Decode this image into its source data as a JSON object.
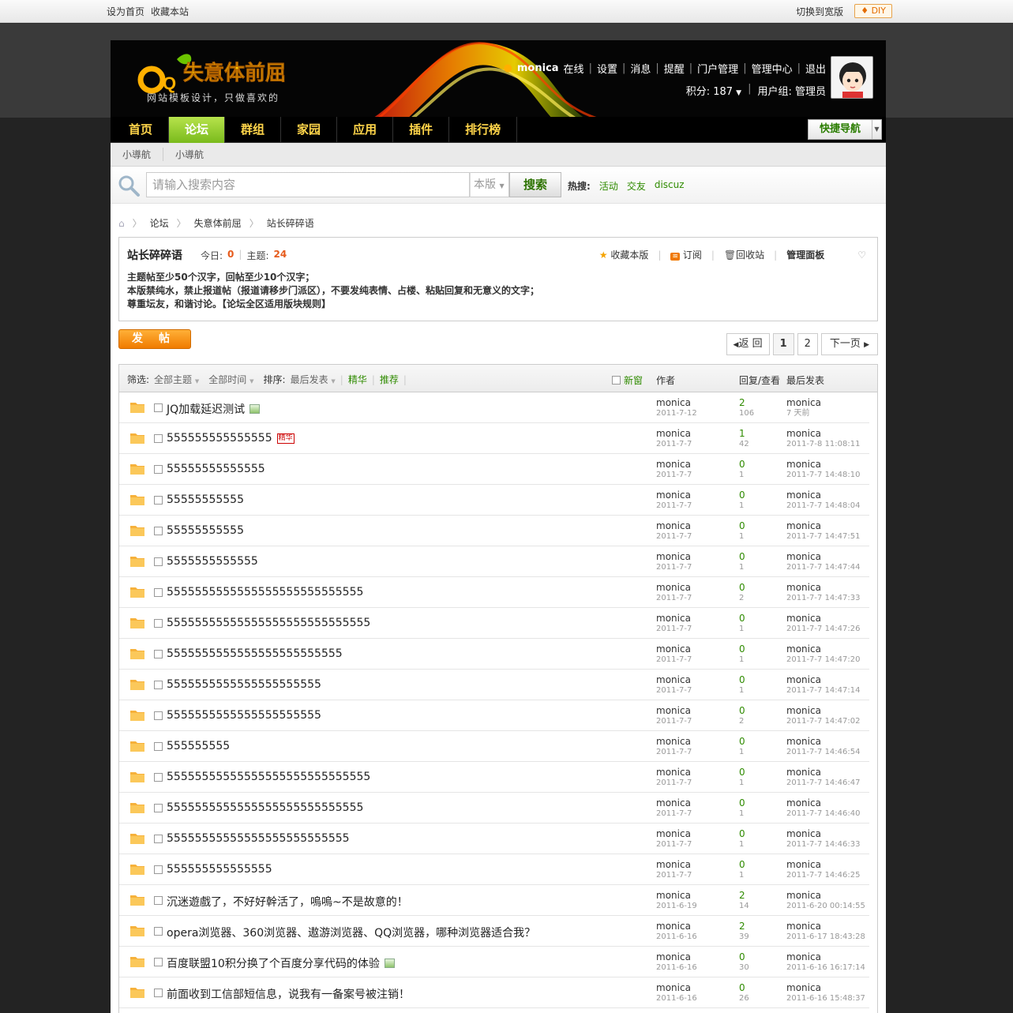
{
  "toptb": {
    "set_home": "设为首页",
    "bookmark": "收藏本站",
    "switch_wide": "切换到宽版",
    "diy": "DIY"
  },
  "header": {
    "logo_text": "失意体前屈",
    "tagline": "网站模板设计，只做喜欢的",
    "user": "monica",
    "online": "在线",
    "links": [
      "设置",
      "消息",
      "提醒",
      "门户管理",
      "管理中心",
      "退出"
    ],
    "credits_label": "积分: 187",
    "usergroup": "用户组: 管理员"
  },
  "nav": {
    "items": [
      "首页",
      "论坛",
      "群组",
      "家园",
      "应用",
      "插件",
      "排行榜"
    ],
    "active": "论坛",
    "quick_nav": "快捷导航"
  },
  "subnav": [
    "小導航",
    "小導航"
  ],
  "search": {
    "placeholder": "请输入搜索内容",
    "type": "本版",
    "button": "搜索",
    "hot_label": "热搜:",
    "hot": [
      "活动",
      "交友",
      "discuz"
    ]
  },
  "breadcrumb": [
    "论坛",
    "失意体前屈",
    "站长碎碎语"
  ],
  "forum": {
    "title": "站长碎碎语",
    "today_label": "今日:",
    "today": "0",
    "topics_label": "主题:",
    "topics": "24",
    "ops": [
      "收藏本版",
      "订阅",
      "回收站",
      "管理面板"
    ],
    "rules": [
      "主题帖至少50个汉字，回帖至少10个汉字；",
      "本版禁纯水，禁止报道帖（报道请移步门派区），不要发纯表情、占楼、粘贴回复和无意义的文字；",
      "尊重坛友，和谐讨论。【论坛全区适用版块规则】"
    ]
  },
  "post_button": "发帖",
  "pager": {
    "prev": "返 回",
    "pages": [
      "1",
      "2"
    ],
    "next": "下一页"
  },
  "table_head": {
    "filter_label": "筛选:",
    "filter_all": "全部主题",
    "time_all": "全部时间",
    "sort_label": "排序:",
    "sort": "最后发表",
    "digest": "精华",
    "recommend": "推荐",
    "newwin": "新窗",
    "author": "作者",
    "replies": "回复/查看",
    "lastpost": "最后发表"
  },
  "threads": [
    {
      "title": "JQ加载延迟测试",
      "badge": "img",
      "author": "monica",
      "date": "2011-7-12",
      "replies": "2",
      "views": "106",
      "last_user": "monica",
      "last_time": "7 天前"
    },
    {
      "title": "555555555555555",
      "badge": "精华",
      "author": "monica",
      "date": "2011-7-7",
      "replies": "1",
      "views": "42",
      "last_user": "monica",
      "last_time": "2011-7-8 11:08:11"
    },
    {
      "title": "55555555555555",
      "badge": "",
      "author": "monica",
      "date": "2011-7-7",
      "replies": "0",
      "views": "1",
      "last_user": "monica",
      "last_time": "2011-7-7 14:48:10"
    },
    {
      "title": "55555555555",
      "badge": "",
      "author": "monica",
      "date": "2011-7-7",
      "replies": "0",
      "views": "1",
      "last_user": "monica",
      "last_time": "2011-7-7 14:48:04"
    },
    {
      "title": "55555555555",
      "badge": "",
      "author": "monica",
      "date": "2011-7-7",
      "replies": "0",
      "views": "1",
      "last_user": "monica",
      "last_time": "2011-7-7 14:47:51"
    },
    {
      "title": "5555555555555",
      "badge": "",
      "author": "monica",
      "date": "2011-7-7",
      "replies": "0",
      "views": "1",
      "last_user": "monica",
      "last_time": "2011-7-7 14:47:44"
    },
    {
      "title": "5555555555555555555555555555",
      "badge": "",
      "author": "monica",
      "date": "2011-7-7",
      "replies": "0",
      "views": "2",
      "last_user": "monica",
      "last_time": "2011-7-7 14:47:33"
    },
    {
      "title": "55555555555555555555555555555",
      "badge": "",
      "author": "monica",
      "date": "2011-7-7",
      "replies": "0",
      "views": "1",
      "last_user": "monica",
      "last_time": "2011-7-7 14:47:26"
    },
    {
      "title": "5555555555555555555555555",
      "badge": "",
      "author": "monica",
      "date": "2011-7-7",
      "replies": "0",
      "views": "1",
      "last_user": "monica",
      "last_time": "2011-7-7 14:47:20"
    },
    {
      "title": "5555555555555555555555",
      "badge": "",
      "author": "monica",
      "date": "2011-7-7",
      "replies": "0",
      "views": "1",
      "last_user": "monica",
      "last_time": "2011-7-7 14:47:14"
    },
    {
      "title": "5555555555555555555555",
      "badge": "",
      "author": "monica",
      "date": "2011-7-7",
      "replies": "0",
      "views": "2",
      "last_user": "monica",
      "last_time": "2011-7-7 14:47:02"
    },
    {
      "title": "555555555",
      "badge": "",
      "author": "monica",
      "date": "2011-7-7",
      "replies": "0",
      "views": "1",
      "last_user": "monica",
      "last_time": "2011-7-7 14:46:54"
    },
    {
      "title": "55555555555555555555555555555",
      "badge": "",
      "author": "monica",
      "date": "2011-7-7",
      "replies": "0",
      "views": "1",
      "last_user": "monica",
      "last_time": "2011-7-7 14:46:47"
    },
    {
      "title": "5555555555555555555555555555",
      "badge": "",
      "author": "monica",
      "date": "2011-7-7",
      "replies": "0",
      "views": "1",
      "last_user": "monica",
      "last_time": "2011-7-7 14:46:40"
    },
    {
      "title": "55555555555555555555555555",
      "badge": "",
      "author": "monica",
      "date": "2011-7-7",
      "replies": "0",
      "views": "1",
      "last_user": "monica",
      "last_time": "2011-7-7 14:46:33"
    },
    {
      "title": "555555555555555",
      "badge": "",
      "author": "monica",
      "date": "2011-7-7",
      "replies": "0",
      "views": "1",
      "last_user": "monica",
      "last_time": "2011-7-7 14:46:25"
    },
    {
      "title": "沉迷遊戲了，不好好幹活了，嗚嗚~不是故意的！",
      "badge": "",
      "author": "monica",
      "date": "2011-6-19",
      "replies": "2",
      "views": "14",
      "last_user": "monica",
      "last_time": "2011-6-20 00:14:55"
    },
    {
      "title": "opera浏览器、360浏览器、遨游浏览器、QQ浏览器，哪种浏览器适合我？",
      "badge": "",
      "author": "monica",
      "date": "2011-6-16",
      "replies": "2",
      "views": "39",
      "last_user": "monica",
      "last_time": "2011-6-17 18:43:28"
    },
    {
      "title": "百度联盟10积分换了个百度分享代码的体验",
      "badge": "img",
      "author": "monica",
      "date": "2011-6-16",
      "replies": "0",
      "views": "30",
      "last_user": "monica",
      "last_time": "2011-6-16 16:17:14"
    },
    {
      "title": "前面收到工信部短信息，说我有一备案号被注销！",
      "badge": "",
      "author": "monica",
      "date": "2011-6-16",
      "replies": "0",
      "views": "26",
      "last_user": "monica",
      "last_time": "2011-6-16 15:48:37"
    }
  ]
}
